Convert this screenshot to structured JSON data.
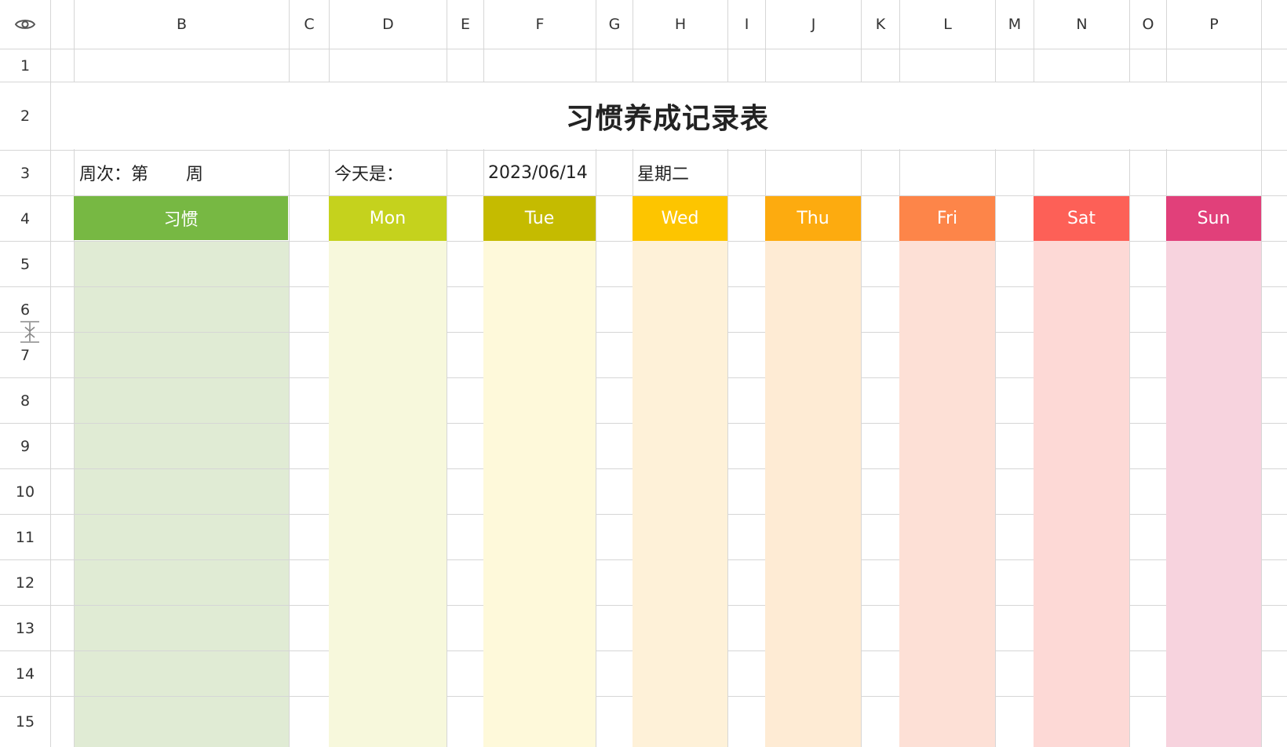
{
  "columns": [
    "B",
    "C",
    "D",
    "E",
    "F",
    "G",
    "H",
    "I",
    "J",
    "K",
    "L",
    "M",
    "N",
    "O",
    "P"
  ],
  "rows": [
    "1",
    "2",
    "3",
    "4",
    "5",
    "6",
    "7",
    "8",
    "9",
    "10",
    "11",
    "12",
    "13",
    "14",
    "15"
  ],
  "sheet": {
    "title": "习惯养成记录表",
    "week_label": "周次：",
    "week_prefix": "第",
    "week_suffix": "周",
    "today_label": "今天是：",
    "date": "2023/06/14",
    "weekday": "星期二",
    "habit_header": "习惯",
    "days": [
      "Mon",
      "Tue",
      "Wed",
      "Thu",
      "Fri",
      "Sat",
      "Sun"
    ]
  },
  "colors": {
    "habit_header": "#77b843",
    "habit_body": "#e0ebd4",
    "days_header": [
      "#c5d21d",
      "#c5bb00",
      "#fdc500",
      "#fdab0f",
      "#fd8549",
      "#fd6057",
      "#e1407a"
    ],
    "days_body": [
      "#f7f8dc",
      "#fef9da",
      "#fef1d8",
      "#feebd4",
      "#fde0d6",
      "#fdd9d6",
      "#f7d3de"
    ]
  },
  "icons": {
    "eye": "eye-icon",
    "resize": "row-resize-icon"
  }
}
